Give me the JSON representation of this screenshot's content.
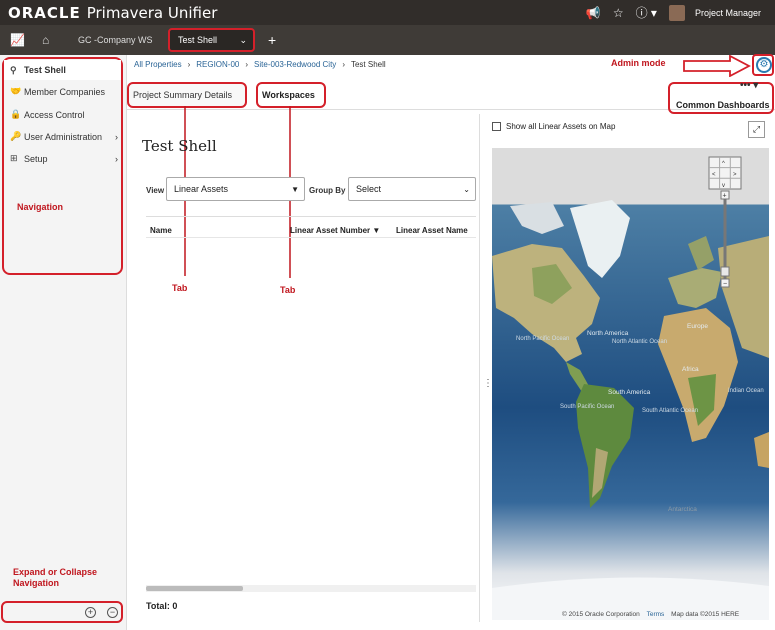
{
  "header": {
    "logo_oracle": "ORACLE",
    "logo_product": "Primavera Unifier",
    "user_name": "Project Manager"
  },
  "tabstrip": {
    "workspace_tab": "GC -Company WS",
    "active_tab": "Test Shell",
    "add_label": "+"
  },
  "nav": {
    "items": [
      {
        "label": "Test Shell"
      },
      {
        "label": "Member Companies"
      },
      {
        "label": "Access Control"
      },
      {
        "label": "User Administration"
      },
      {
        "label": "Setup"
      }
    ],
    "annotation": "Navigation",
    "expand_annotation": "Expand or Collapse Navigation"
  },
  "breadcrumb": {
    "items": [
      "All Properties",
      "REGION-00",
      "Site-003-Redwood City",
      "Test Shell"
    ]
  },
  "annotations": {
    "admin_mode": "Admin mode",
    "tab1": "Tab",
    "tab2": "Tab"
  },
  "tabs": {
    "project_summary": "Project Summary Details",
    "workspaces": "Workspaces",
    "common_dashboards": "Common Dashboards",
    "more": "•••"
  },
  "content": {
    "title": "Test Shell",
    "view_label": "View",
    "view_value": "Linear Assets",
    "group_label": "Group By",
    "group_value": "Select",
    "columns": [
      "Name",
      "Linear Asset Number",
      "Linear Asset Name"
    ],
    "total": "Total: 0"
  },
  "map": {
    "show_all_label": "Show all Linear Assets on Map",
    "labels": {
      "north_america": "North America",
      "north_atlantic": "North Atlantic Ocean",
      "north_pacific": "North Pacific Ocean",
      "europe": "Europe",
      "africa": "Africa",
      "south_america": "South America",
      "south_pacific": "South Pacific Ocean",
      "south_atlantic": "South Atlantic Ocean",
      "indian": "Indian Ocean",
      "antarctica": "Antarctica"
    },
    "copyright": "© 2015 Oracle Corporation",
    "terms": "Terms",
    "map_data": "Map data ©2015 HERE"
  },
  "colors": {
    "header_bg": "#312d2a",
    "tabstrip_bg": "#3f3b37",
    "annotation_red": "#c0161e",
    "link_blue": "#2a6496"
  }
}
